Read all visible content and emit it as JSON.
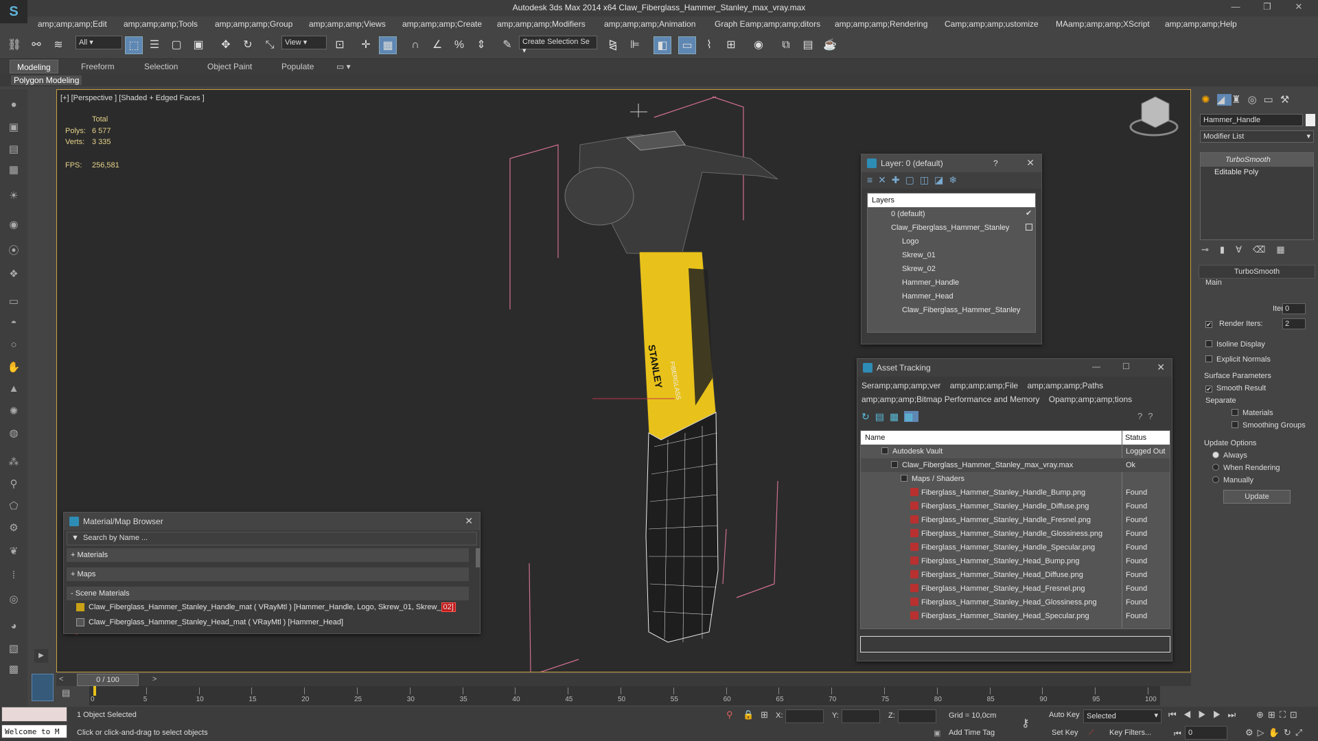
{
  "window": {
    "title": "Autodesk 3ds Max  2014 x64     Claw_Fiberglass_Hammer_Stanley_max_vray.max",
    "minimize": "—",
    "maximize": "❐",
    "close": "✕"
  },
  "menu": [
    "amp;amp;amp;Edit",
    "amp;amp;amp;Tools",
    "amp;amp;amp;Group",
    "amp;amp;amp;Views",
    "amp;amp;amp;Create",
    "amp;amp;amp;Modifiers",
    "amp;amp;amp;Animation",
    "Graph Eamp;amp;amp;ditors",
    "amp;amp;amp;Rendering",
    "Camp;amp;amp;ustomize",
    "MAamp;amp;amp;XScript",
    "amp;amp;amp;Help"
  ],
  "toolbar": {
    "filter": "All",
    "refcoord": "View",
    "selset": "Create Selection Se"
  },
  "ribbon": {
    "tabs": [
      "Modeling",
      "Freeform",
      "Selection",
      "Object Paint",
      "Populate"
    ],
    "sub": "Polygon Modeling"
  },
  "viewport": {
    "label": "[+] [Perspective ] [Shaded + Edged Faces ]",
    "stats": {
      "total": "Total",
      "polys_label": "Polys:",
      "polys": "6 577",
      "verts_label": "Verts:",
      "verts": "3 335",
      "fps_label": "FPS:",
      "fps": "256,581"
    },
    "logo_text": "STANLEY",
    "logo_sub": "FIBERGLASS"
  },
  "command_panel": {
    "object_name": "Hammer_Handle",
    "modifier_list": "Modifier List",
    "stack": [
      "TurboSmooth",
      "Editable Poly"
    ],
    "rollout_title": "TurboSmooth",
    "main": "Main",
    "iterations_label": "Iterations:",
    "iterations": "0",
    "render_iters_label": "Render Iters:",
    "render_iters": "2",
    "isoline": "Isoline Display",
    "explicit": "Explicit Normals",
    "surface_params": "Surface Parameters",
    "smooth_result": "Smooth Result",
    "separate": "Separate",
    "materials": "Materials",
    "smoothing_groups": "Smoothing Groups",
    "update_options": "Update Options",
    "always": "Always",
    "when_rendering": "When Rendering",
    "manually": "Manually",
    "update": "Update"
  },
  "layer_dialog": {
    "title": "Layer: 0 (default)",
    "help": "?",
    "header": "Layers",
    "items": [
      "0 (default)",
      "Claw_Fiberglass_Hammer_Stanley",
      "Logo",
      "Skrew_01",
      "Skrew_02",
      "Hammer_Handle",
      "Hammer_Head",
      "Claw_Fiberglass_Hammer_Stanley"
    ]
  },
  "asset_tracking": {
    "title": "Asset Tracking",
    "menu1": [
      "Seramp;amp;amp;ver",
      "amp;amp;amp;File",
      "amp;amp;amp;Paths"
    ],
    "menu2": [
      "amp;amp;amp;Bitmap Performance and Memory",
      "Opamp;amp;amp;tions"
    ],
    "col_name": "Name",
    "col_status": "Status",
    "rows": [
      {
        "name": "Autodesk Vault",
        "status": "Logged Out"
      },
      {
        "name": "Claw_Fiberglass_Hammer_Stanley_max_vray.max",
        "status": "Ok"
      },
      {
        "name": "Maps / Shaders",
        "status": ""
      },
      {
        "name": "Fiberglass_Hammer_Stanley_Handle_Bump.png",
        "status": "Found"
      },
      {
        "name": "Fiberglass_Hammer_Stanley_Handle_Diffuse.png",
        "status": "Found"
      },
      {
        "name": "Fiberglass_Hammer_Stanley_Handle_Fresnel.png",
        "status": "Found"
      },
      {
        "name": "Fiberglass_Hammer_Stanley_Handle_Glossiness.png",
        "status": "Found"
      },
      {
        "name": "Fiberglass_Hammer_Stanley_Handle_Specular.png",
        "status": "Found"
      },
      {
        "name": "Fiberglass_Hammer_Stanley_Head_Bump.png",
        "status": "Found"
      },
      {
        "name": "Fiberglass_Hammer_Stanley_Head_Diffuse.png",
        "status": "Found"
      },
      {
        "name": "Fiberglass_Hammer_Stanley_Head_Fresnel.png",
        "status": "Found"
      },
      {
        "name": "Fiberglass_Hammer_Stanley_Head_Glossiness.png",
        "status": "Found"
      },
      {
        "name": "Fiberglass_Hammer_Stanley_Head_Specular.png",
        "status": "Found"
      }
    ]
  },
  "material_browser": {
    "title": "Material/Map Browser",
    "search_placeholder": "Search by Name ...",
    "materials": "+ Materials",
    "maps": "+ Maps",
    "scene_materials": "- Scene Materials",
    "item1_text": "Claw_Fiberglass_Hammer_Stanley_Handle_mat  ( VRayMtl )  [Hammer_Handle, Logo, Skrew_01, Skrew_",
    "item1_tail": "02]",
    "item2": "Claw_Fiberglass_Hammer_Stanley_Head_mat  ( VRayMtl )  [Hammer_Head]"
  },
  "timeline": {
    "frame": "0 / 100",
    "ticks": [
      "0",
      "5",
      "10",
      "15",
      "20",
      "25",
      "30",
      "35",
      "40",
      "45",
      "50",
      "55",
      "60",
      "65",
      "70",
      "75",
      "80",
      "85",
      "90",
      "95",
      "100"
    ],
    "progress": 0
  },
  "status": {
    "welcome": "Welcome to M",
    "selected": "1 Object Selected",
    "prompt": "Click or click-and-drag to select objects",
    "x": "X:",
    "y": "Y:",
    "z": "Z:",
    "grid": "Grid = 10,0cm",
    "add_time_tag": "Add Time Tag",
    "auto_key": "Auto Key",
    "set_key": "Set Key",
    "key_mode": "Selected",
    "key_filters": "Key Filters...",
    "frame": "0"
  },
  "colors": {
    "accent": "#5f87b3",
    "viewport_border": "#c8a040",
    "hammer_yellow": "#e8c21a",
    "stats": "#e6d38a"
  }
}
